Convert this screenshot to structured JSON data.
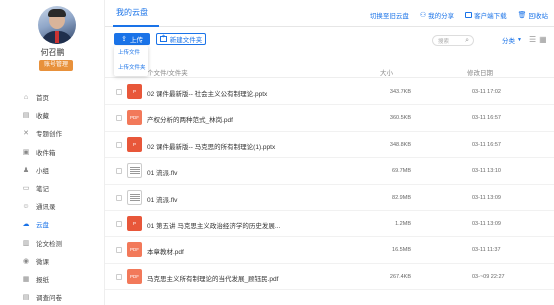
{
  "user": {
    "name": "何召鹏",
    "role": "账号管理"
  },
  "nav": [
    {
      "label": "首页",
      "icon": "home-icon",
      "glyph": "⌂"
    },
    {
      "label": "收藏",
      "icon": "bookmark-icon",
      "glyph": "▤"
    },
    {
      "label": "专题创作",
      "icon": "topic-icon",
      "glyph": "✕"
    },
    {
      "label": "收件箱",
      "icon": "inbox-icon",
      "glyph": "▣"
    },
    {
      "label": "小组",
      "icon": "group-icon",
      "glyph": "♟"
    },
    {
      "label": "笔记",
      "icon": "note-icon",
      "glyph": "▭"
    },
    {
      "label": "通讯录",
      "icon": "contacts-icon",
      "glyph": "☺"
    },
    {
      "label": "云盘",
      "icon": "cloud-icon",
      "glyph": "☁",
      "active": true
    },
    {
      "label": "论文检测",
      "icon": "paper-check-icon",
      "glyph": "▥"
    },
    {
      "label": "微课",
      "icon": "microlesson-icon",
      "glyph": "◉"
    },
    {
      "label": "报纸",
      "icon": "newspaper-icon",
      "glyph": "▦"
    },
    {
      "label": "调查问卷",
      "icon": "survey-icon",
      "glyph": "▤"
    }
  ],
  "header": {
    "title": "我的云盘",
    "links": [
      {
        "label": "切换至旧云盘",
        "icon": "none"
      },
      {
        "label": "我的分享",
        "icon": "share-icon"
      },
      {
        "label": "客户端下载",
        "icon": "download-icon"
      },
      {
        "label": "回收站",
        "icon": "trash-icon"
      }
    ]
  },
  "toolbar": {
    "upload": "上传",
    "upload_menu": [
      "上传文件",
      "上传文件夹"
    ],
    "new_folder": "新建文件夹",
    "search_placeholder": "搜索",
    "sort": "分类"
  },
  "table": {
    "columns": {
      "name": "个文件/文件夹",
      "size": "大小",
      "date": "修改日期"
    },
    "rows": [
      {
        "type": "ppt",
        "name": "02 课件最新版-- 社会主义公有制理论.pptx",
        "size": "343.7KB",
        "date": "03-11 17:02"
      },
      {
        "type": "pdf",
        "name": "产权分析的两种范式_林岗.pdf",
        "size": "360.5KB",
        "date": "03-11 16:57"
      },
      {
        "type": "ppt",
        "name": "02 课件最新版-- 马克思的所有制理论(1).pptx",
        "size": "348.8KB",
        "date": "03-11 16:57"
      },
      {
        "type": "video",
        "name": "01 流派.flv",
        "size": "69.7MB",
        "date": "03-11 13:10"
      },
      {
        "type": "video",
        "name": "01 流派.flv",
        "size": "82.9MB",
        "date": "03-11 13:09"
      },
      {
        "type": "ppt",
        "name": "01 第五讲 马克思主义政治经济学的历史发展...",
        "size": "1.2MB",
        "date": "03-11 13:09"
      },
      {
        "type": "pdf",
        "name": "本章教材.pdf",
        "size": "16.5MB",
        "date": "03-11 11:37"
      },
      {
        "type": "pdf",
        "name": "马克思主义所有制理论的当代发展_顾钰民.pdf",
        "size": "267.4KB",
        "date": "03-~09 22:27"
      }
    ]
  },
  "colors": {
    "accent": "#1a73e8",
    "badge": "#e8913b",
    "ppt": "#e8573a",
    "pdf": "#f2795a"
  }
}
